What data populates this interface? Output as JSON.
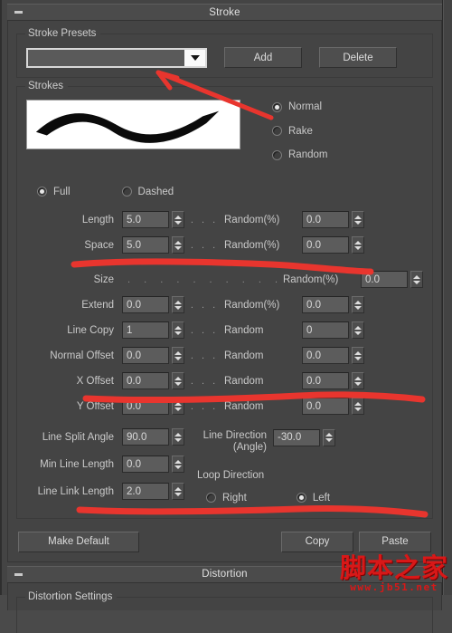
{
  "window": {
    "title": "Stroke",
    "collapse_icon": "minus-icon"
  },
  "presets": {
    "group_label": "Stroke Presets",
    "combo_value": "",
    "combo_arrow_icon": "chevron-down-icon",
    "add_label": "Add",
    "delete_label": "Delete"
  },
  "strokes": {
    "group_label": "Strokes",
    "preview_name": "stroke-preview",
    "modes": [
      {
        "label": "Normal",
        "selected": true
      },
      {
        "label": "Rake",
        "selected": false
      },
      {
        "label": "Random",
        "selected": false
      }
    ],
    "fill_modes": [
      {
        "label": "Full",
        "selected": true
      },
      {
        "label": "Dashed",
        "selected": false
      }
    ],
    "params": [
      {
        "label": "Length",
        "value": "5.0",
        "random_label": "Random(%)",
        "random_value": "0.0",
        "leader": ". . ."
      },
      {
        "label": "Space",
        "value": "5.0",
        "random_label": "Random(%)",
        "random_value": "0.0",
        "leader": ". . ."
      },
      {
        "label": "Size",
        "value": null,
        "random_label": "Random(%)",
        "random_value": "0.0",
        "leader": ". . . . . . . . . . . . . ."
      },
      {
        "label": "Extend",
        "value": "0.0",
        "random_label": "Random(%)",
        "random_value": "0.0",
        "leader": ". . ."
      },
      {
        "label": "Line Copy",
        "value": "1",
        "random_label": "Random",
        "random_value": "0",
        "leader": ". . ."
      },
      {
        "label": "Normal Offset",
        "value": "0.0",
        "random_label": "Random",
        "random_value": "0.0",
        "leader": ". . ."
      },
      {
        "label": "X Offset",
        "value": "0.0",
        "random_label": "Random",
        "random_value": "0.0",
        "leader": ". . ."
      },
      {
        "label": "Y Offset",
        "value": "0.0",
        "random_label": "Random",
        "random_value": "0.0",
        "leader": ". . ."
      }
    ],
    "lower_left": [
      {
        "label": "Line Split Angle",
        "value": "90.0"
      },
      {
        "label": "Min Line Length",
        "value": "0.0"
      },
      {
        "label": "Line Link Length",
        "value": "2.0"
      }
    ],
    "line_direction": {
      "label_line1": "Line Direction",
      "label_line2": "(Angle)",
      "value": "-30.0"
    },
    "loop_direction": {
      "title": "Loop Direction",
      "options": [
        {
          "label": "Right",
          "selected": false
        },
        {
          "label": "Left",
          "selected": true
        }
      ]
    }
  },
  "footer": {
    "make_default_label": "Make Default",
    "copy_label": "Copy",
    "paste_label": "Paste"
  },
  "distortion": {
    "title": "Distortion",
    "collapse_icon": "minus-icon",
    "settings_label": "Distortion Settings"
  },
  "watermark": {
    "text_cn": "脚本之家",
    "text_url": "www.jb51.net",
    "color": "#d81818"
  },
  "annotation": {
    "color": "#e8352e",
    "strokes": 4
  }
}
